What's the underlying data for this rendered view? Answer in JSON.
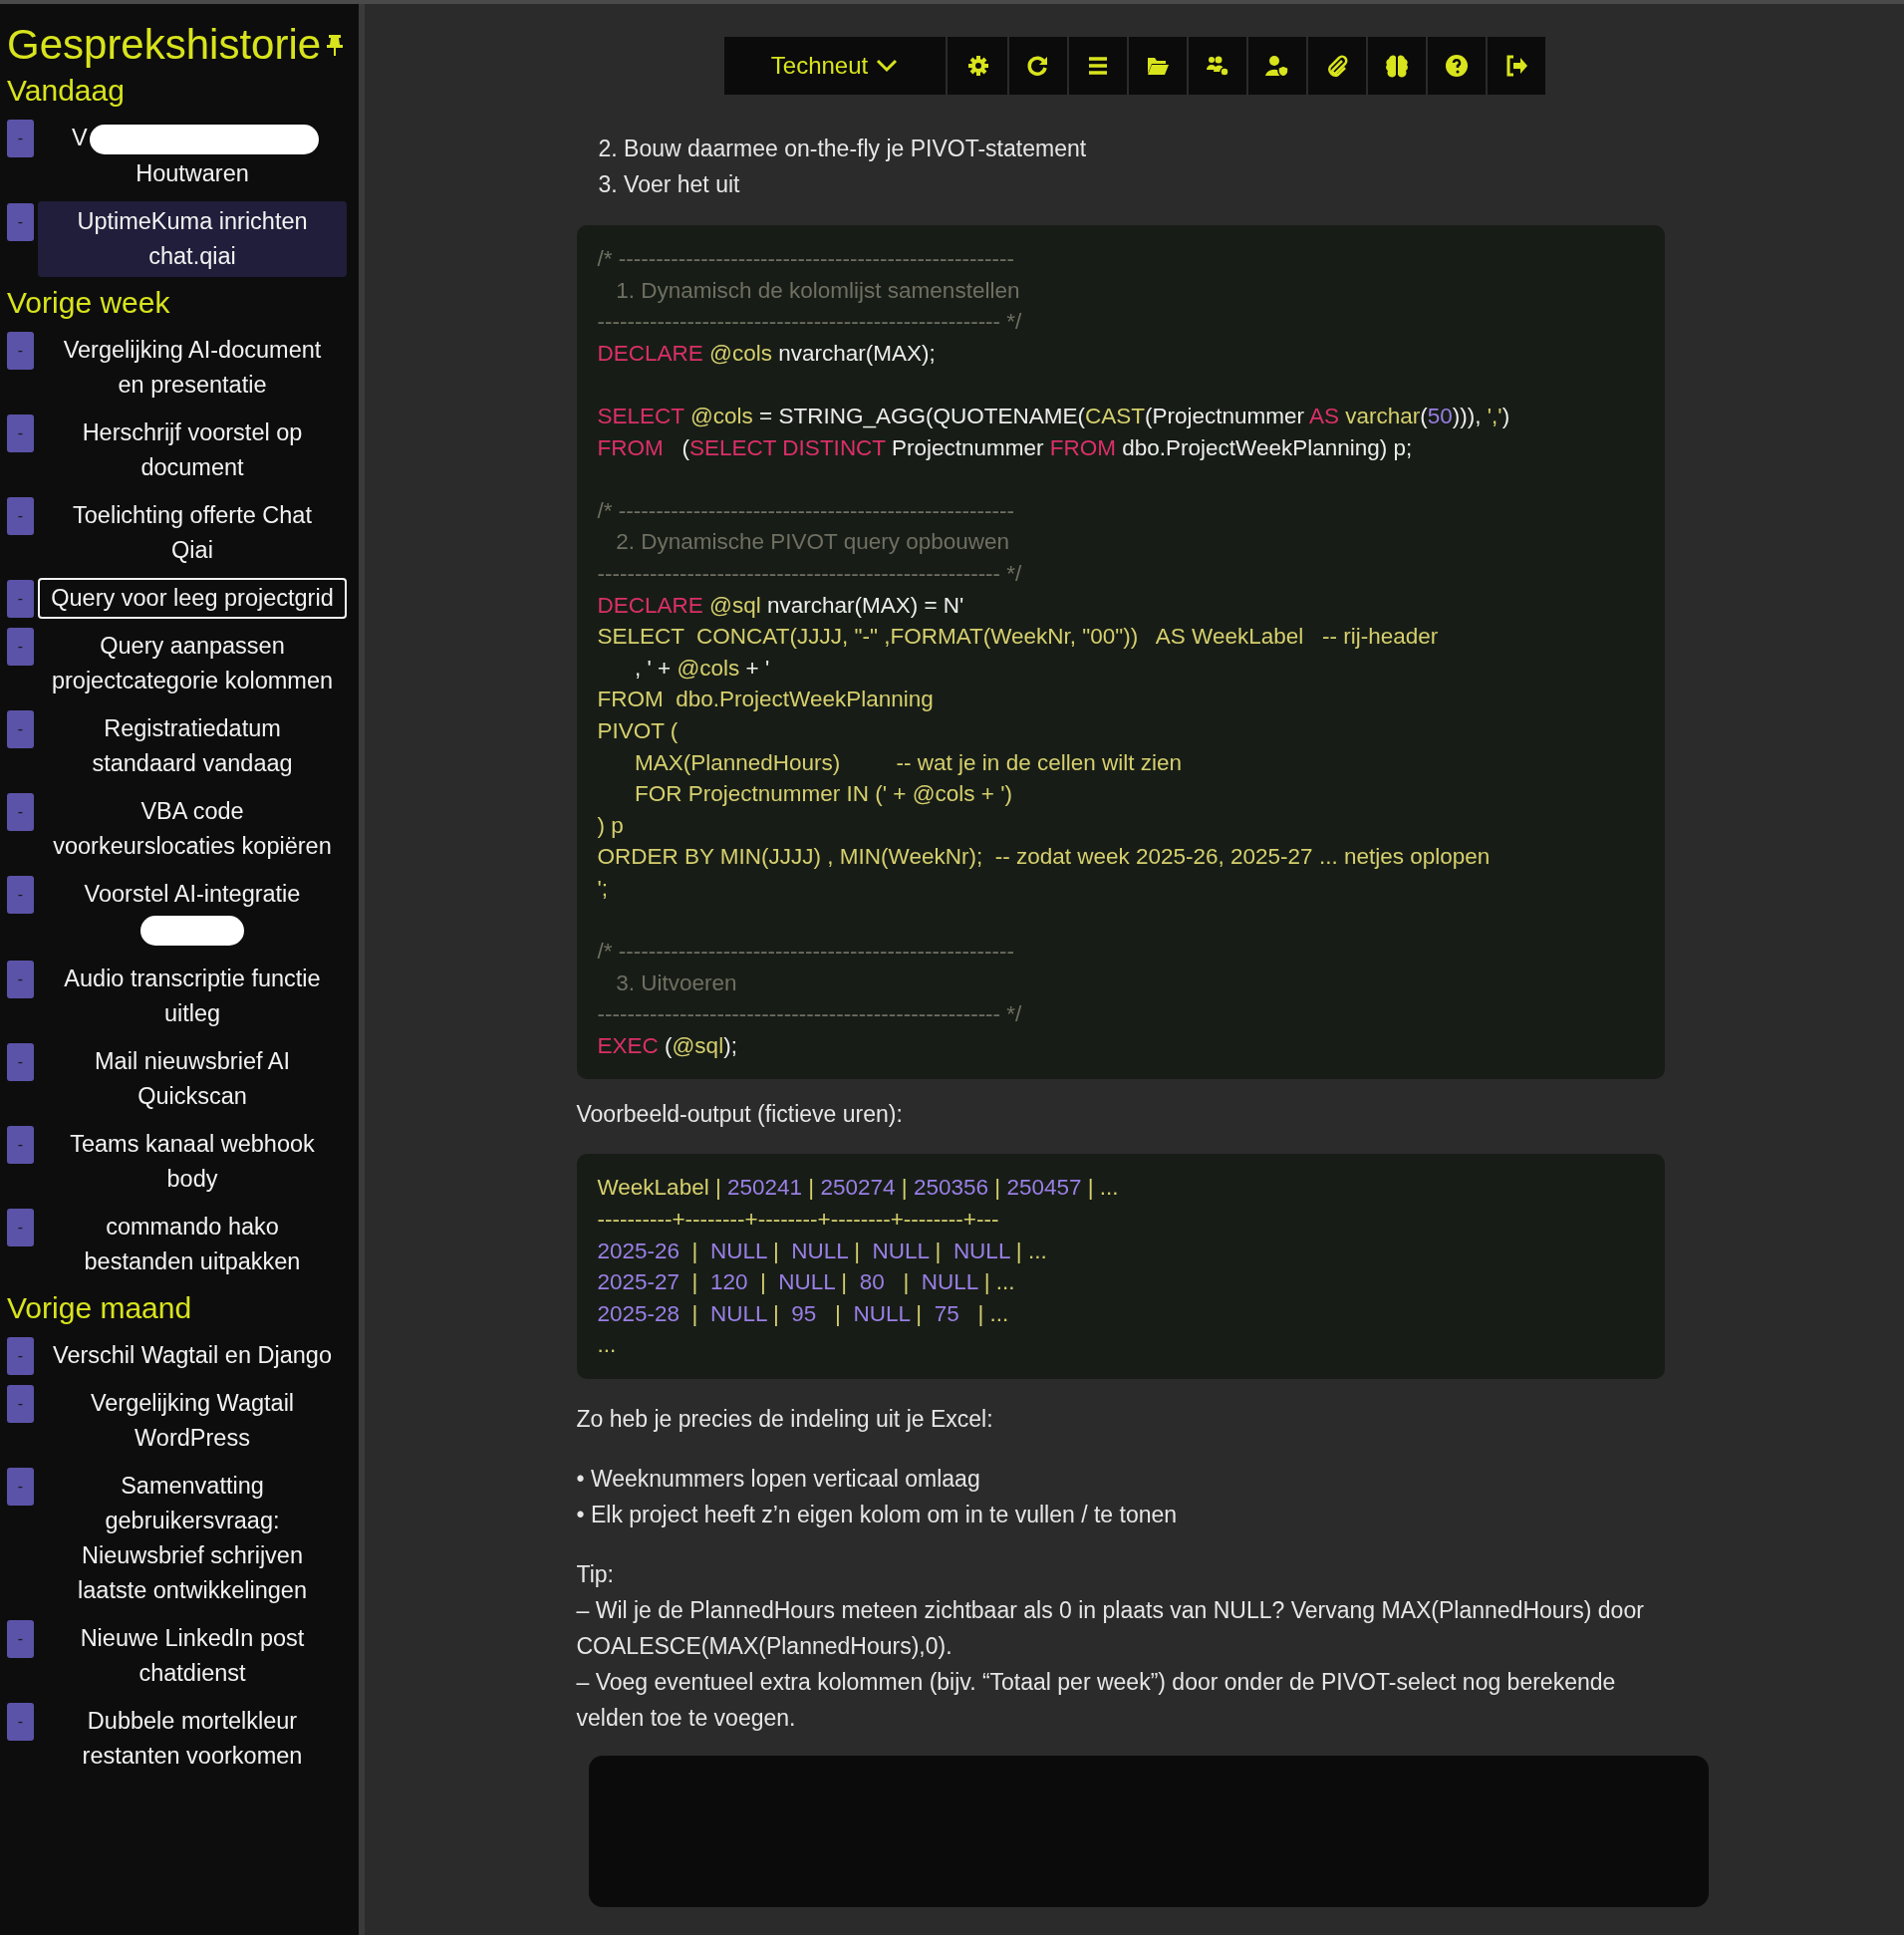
{
  "sidebar": {
    "title": "Gesprekshistorie",
    "groups": [
      {
        "heading": "Vandaag",
        "items": [
          {
            "title": "V",
            "title_line_2": "Houtwaren",
            "redacted": true,
            "selected": false,
            "focused": false,
            "button_label": "-"
          },
          {
            "title": "UptimeKuma inrichten chat.qiai",
            "selected": true,
            "focused": false,
            "button_label": "-"
          }
        ]
      },
      {
        "heading": "Vorige week",
        "items": [
          {
            "title": "Vergelijking AI-document en presentatie",
            "selected": false,
            "focused": false,
            "button_label": "-"
          },
          {
            "title": "Herschrijf voorstel op document",
            "selected": false,
            "focused": false,
            "button_label": "-"
          },
          {
            "title": "Toelichting offerte Chat Qiai",
            "selected": false,
            "focused": false,
            "button_label": "-"
          },
          {
            "title": "Query voor leeg projectgrid",
            "selected": false,
            "focused": true,
            "button_label": "-"
          },
          {
            "title": "Query aanpassen projectcategorie kolommen",
            "selected": false,
            "focused": false,
            "button_label": "-"
          },
          {
            "title": "Registratiedatum standaard vandaag",
            "selected": false,
            "focused": false,
            "button_label": "-"
          },
          {
            "title": "VBA code voorkeurslocaties kopiëren",
            "selected": false,
            "focused": false,
            "button_label": "-"
          },
          {
            "title": "Voorstel AI-integratie",
            "redacted": true,
            "selected": false,
            "focused": false,
            "button_label": "-"
          },
          {
            "title": "Audio transcriptie functie uitleg",
            "selected": false,
            "focused": false,
            "button_label": "-"
          },
          {
            "title": "Mail nieuwsbrief AI Quickscan",
            "selected": false,
            "focused": false,
            "button_label": "-"
          },
          {
            "title": "Teams kanaal webhook body",
            "selected": false,
            "focused": false,
            "button_label": "-"
          },
          {
            "title": "commando hako bestanden uitpakken",
            "selected": false,
            "focused": false,
            "button_label": "-"
          }
        ]
      },
      {
        "heading": "Vorige maand",
        "items": [
          {
            "title": "Verschil Wagtail en Django",
            "selected": false,
            "focused": false,
            "button_label": "-"
          },
          {
            "title": "Vergelijking Wagtail WordPress",
            "selected": false,
            "focused": false,
            "button_label": "-"
          },
          {
            "title": "Samenvatting gebruikersvraag: Nieuwsbrief schrijven laatste ontwikkelingen",
            "selected": false,
            "focused": false,
            "button_label": "-"
          },
          {
            "title": "Nieuwe LinkedIn post chatdienst",
            "selected": false,
            "focused": false,
            "button_label": "-"
          },
          {
            "title": "Dubbele mortelkleur restanten voorkomen",
            "selected": false,
            "focused": false,
            "button_label": "-"
          }
        ]
      }
    ]
  },
  "toolbar": {
    "profile_dropdown": "Techneut"
  },
  "message": {
    "steps": [
      "2. Bouw daarmee on-the-fly je PIVOT-statement",
      "3. Voer het uit"
    ],
    "code_block": [
      [
        [
          {
            "kind": "comment",
            "text": "/* -----------------------------------------------------"
          }
        ],
        [
          {
            "kind": "comment",
            "text": "   1. Dynamisch de kolomlijst samenstellen"
          }
        ],
        [
          {
            "kind": "comment",
            "text": "------------------------------------------------------ */"
          }
        ],
        [
          {
            "kind": "kw",
            "text": "DECLARE "
          },
          {
            "kind": "var",
            "text": "@cols"
          },
          {
            "kind": "plain",
            "text": " nvarchar(MAX);"
          }
        ]
      ],
      [
        [
          {
            "kind": "kw",
            "text": "SELECT "
          },
          {
            "kind": "var",
            "text": "@cols"
          },
          {
            "kind": "plain",
            "text": " = STRING_AGG(QUOTENAME("
          },
          {
            "kind": "var",
            "text": "CAST"
          },
          {
            "kind": "plain",
            "text": "(Projectnummer "
          },
          {
            "kind": "kw",
            "text": "AS "
          },
          {
            "kind": "var",
            "text": "varchar"
          },
          {
            "kind": "plain",
            "text": "("
          },
          {
            "kind": "num",
            "text": "50"
          },
          {
            "kind": "plain",
            "text": "))), "
          },
          {
            "kind": "var",
            "text": "','"
          },
          {
            "kind": "plain",
            "text": ")"
          }
        ],
        [
          {
            "kind": "kw",
            "text": "FROM"
          },
          {
            "kind": "plain",
            "text": "   ("
          },
          {
            "kind": "kw",
            "text": "SELECT DISTINCT"
          },
          {
            "kind": "plain",
            "text": " Projectnummer "
          },
          {
            "kind": "kw",
            "text": "FROM"
          },
          {
            "kind": "plain",
            "text": " dbo.ProjectWeekPlanning) p;"
          }
        ]
      ],
      [
        [
          {
            "kind": "comment",
            "text": "/* -----------------------------------------------------"
          }
        ],
        [
          {
            "kind": "comment",
            "text": "   2. Dynamische PIVOT query opbouwen"
          }
        ],
        [
          {
            "kind": "comment",
            "text": "------------------------------------------------------ */"
          }
        ],
        [
          {
            "kind": "kw",
            "text": "DECLARE "
          },
          {
            "kind": "var",
            "text": "@sql"
          },
          {
            "kind": "plain",
            "text": " nvarchar(MAX) = N'"
          }
        ],
        [
          {
            "kind": "str",
            "text": "SELECT  CONCAT(JJJJ, \"-\" ,FORMAT(WeekNr, \"00\"))   AS WeekLabel   -- rij-header"
          }
        ],
        [
          {
            "kind": "plain",
            "text": "      , ' + "
          },
          {
            "kind": "var",
            "text": "@cols"
          },
          {
            "kind": "plain",
            "text": " + '"
          }
        ],
        [
          {
            "kind": "str",
            "text": "FROM  dbo.ProjectWeekPlanning"
          }
        ],
        [
          {
            "kind": "str",
            "text": "PIVOT ("
          }
        ],
        [
          {
            "kind": "str",
            "text": "      MAX(PlannedHours)         -- wat je in de cellen wilt zien"
          }
        ],
        [
          {
            "kind": "str",
            "text": "      FOR Projectnummer IN (' + @cols + ')"
          }
        ],
        [
          {
            "kind": "str",
            "text": ") p"
          }
        ],
        [
          {
            "kind": "str",
            "text": "ORDER BY MIN(JJJJ) , MIN(WeekNr);  -- zodat week 2025-26, 2025-27 ... netjes oplopen"
          }
        ],
        [
          {
            "kind": "str",
            "text": "';"
          }
        ]
      ],
      [
        [
          {
            "kind": "comment",
            "text": "/* -----------------------------------------------------"
          }
        ],
        [
          {
            "kind": "comment",
            "text": "   3. Uitvoeren"
          }
        ],
        [
          {
            "kind": "comment",
            "text": "------------------------------------------------------ */"
          }
        ],
        [
          {
            "kind": "kw",
            "text": "EXEC"
          },
          {
            "kind": "plain",
            "text": " ("
          },
          {
            "kind": "var",
            "text": "@sql"
          },
          {
            "kind": "plain",
            "text": ");"
          }
        ]
      ]
    ],
    "output_intro": "Voorbeeld-output (fictieve uren):",
    "output_block": [
      [
        [
          {
            "kind": "str",
            "text": "WeekLabel | "
          },
          {
            "kind": "num",
            "text": "250241"
          },
          {
            "kind": "str",
            "text": " | "
          },
          {
            "kind": "num",
            "text": "250274"
          },
          {
            "kind": "str",
            "text": " | "
          },
          {
            "kind": "num",
            "text": "250356"
          },
          {
            "kind": "str",
            "text": " | "
          },
          {
            "kind": "num",
            "text": "250457"
          },
          {
            "kind": "str",
            "text": " | ..."
          }
        ],
        [
          {
            "kind": "str",
            "text": "----------+--------+--------+--------+--------+---"
          }
        ],
        [
          {
            "kind": "num",
            "text": "2025-26"
          },
          {
            "kind": "str",
            "text": "  |  "
          },
          {
            "kind": "num",
            "text": "NULL"
          },
          {
            "kind": "str",
            "text": " |  "
          },
          {
            "kind": "num",
            "text": "NULL"
          },
          {
            "kind": "str",
            "text": " |  "
          },
          {
            "kind": "num",
            "text": "NULL"
          },
          {
            "kind": "str",
            "text": " |  "
          },
          {
            "kind": "num",
            "text": "NULL"
          },
          {
            "kind": "str",
            "text": " | ..."
          }
        ],
        [
          {
            "kind": "num",
            "text": "2025-27"
          },
          {
            "kind": "str",
            "text": "  |  "
          },
          {
            "kind": "num",
            "text": "120"
          },
          {
            "kind": "str",
            "text": "  |  "
          },
          {
            "kind": "num",
            "text": "NULL"
          },
          {
            "kind": "str",
            "text": " |  "
          },
          {
            "kind": "num",
            "text": "80"
          },
          {
            "kind": "str",
            "text": "   |  "
          },
          {
            "kind": "num",
            "text": "NULL"
          },
          {
            "kind": "str",
            "text": " | ..."
          }
        ],
        [
          {
            "kind": "num",
            "text": "2025-28"
          },
          {
            "kind": "str",
            "text": "  |  "
          },
          {
            "kind": "num",
            "text": "NULL"
          },
          {
            "kind": "str",
            "text": " |  "
          },
          {
            "kind": "num",
            "text": "95"
          },
          {
            "kind": "str",
            "text": "   |  "
          },
          {
            "kind": "num",
            "text": "NULL"
          },
          {
            "kind": "str",
            "text": " |  "
          },
          {
            "kind": "num",
            "text": "75"
          },
          {
            "kind": "str",
            "text": "   | ..."
          }
        ],
        [
          {
            "kind": "str",
            "text": "..."
          }
        ]
      ]
    ],
    "summary": "Zo heb je precies de indeling uit je Excel:",
    "bullets": [
      "• Weeknummers lopen verticaal omlaag",
      "• Elk project heeft z’n eigen kolom om in te vullen / te tonen"
    ],
    "tip_heading": "Tip:",
    "tips": [
      "– Wil je de PlannedHours meteen zichtbaar als 0 in plaats van NULL? Vervang MAX(PlannedHours) door COALESCE(MAX(PlannedHours),0).",
      "– Voeg eventueel extra kolommen (bijv. “Totaal per week”) door onder de PIVOT-select nog berekende velden toe te voegen."
    ]
  }
}
